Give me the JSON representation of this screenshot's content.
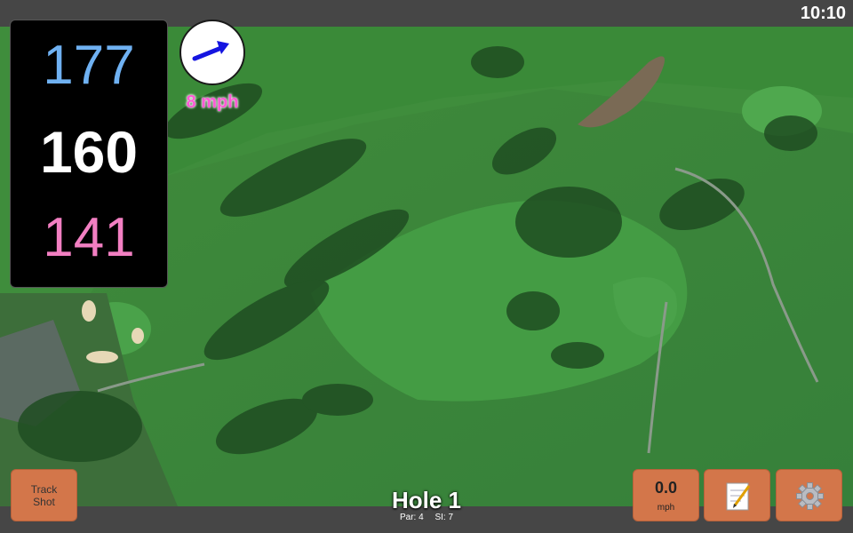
{
  "status": {
    "time": "10:10"
  },
  "yardage": {
    "back": "177",
    "middle": "160",
    "front": "141"
  },
  "wind": {
    "speed": "8 mph",
    "direction_icon": "arrow-icon",
    "arrow_color": "#1515e0"
  },
  "buttons": {
    "track_shot": "Track Shot",
    "speed_value": "0.0",
    "speed_unit": "mph",
    "notes_icon": "notepad-icon",
    "settings_icon": "gear-icon"
  },
  "hole": {
    "title": "Hole 1",
    "par": "Par: 4",
    "si": "SI: 7"
  },
  "colors": {
    "button": "#d3764a",
    "back_yardage": "#6fb1f2",
    "front_yardage": "#f27fc2",
    "wind_text": "#ff5ad6"
  }
}
